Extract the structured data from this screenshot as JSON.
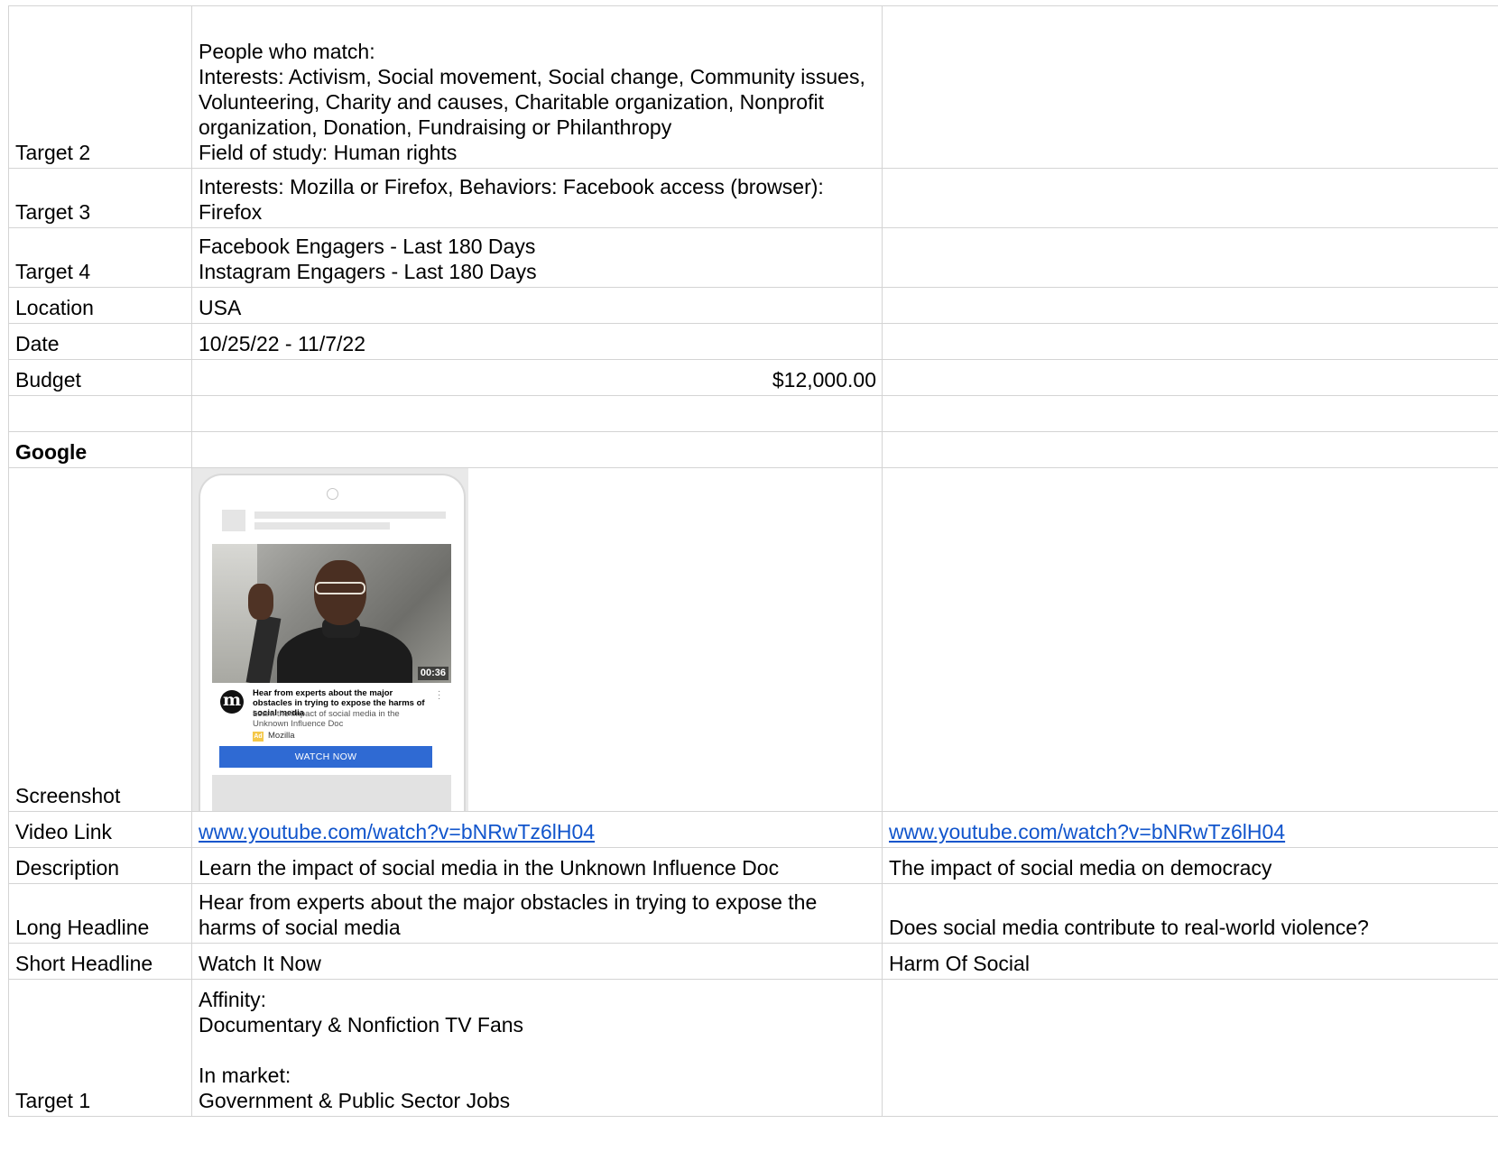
{
  "rows": {
    "target2": {
      "label": "Target 2",
      "value": "People who match:\nInterests: Activism, Social movement, Social change, Community issues, Volunteering, Charity and causes, Charitable organization, Nonprofit organization, Donation, Fundraising or Philanthropy\nField of study: Human rights",
      "value2": ""
    },
    "target3": {
      "label": "Target 3",
      "value": "Interests: Mozilla or Firefox, Behaviors: Facebook access (browser): Firefox"
    },
    "target4": {
      "label": "Target 4",
      "value": "Facebook Engagers - Last 180 Days\nInstagram Engagers - Last 180 Days"
    },
    "location": {
      "label": "Location",
      "value": "USA"
    },
    "date": {
      "label": "Date",
      "value": "10/25/22 - 11/7/22"
    },
    "budget": {
      "label": "Budget",
      "value": "$12,000.00"
    },
    "google": {
      "label": "Google"
    },
    "screenshot": {
      "label": "Screenshot"
    },
    "video_link": {
      "label": "Video Link",
      "value": "www.youtube.com/watch?v=bNRwTz6lH04",
      "value2": "www.youtube.com/watch?v=bNRwTz6lH04"
    },
    "description": {
      "label": "Description",
      "value": "Learn the impact of social media in the Unknown Influence Doc",
      "value2": "The impact of social media on democracy"
    },
    "long_headline": {
      "label": "Long Headline",
      "value": "Hear from experts about the major obstacles in trying to expose the harms of social media",
      "value2": "Does social media contribute to real-world violence?"
    },
    "short_headline": {
      "label": "Short Headline",
      "value": "Watch It Now",
      "value2": "Harm Of Social"
    },
    "target1": {
      "label": "Target 1",
      "value": "Affinity:\nDocumentary & Nonfiction TV Fans\n\nIn market:\nGovernment & Public Sector Jobs"
    }
  },
  "ad_preview": {
    "duration": "00:36",
    "logo_letter": "m",
    "headline": "Hear from experts about the major obstacles in trying to expose the harms of social media",
    "description": "Learn the impact of social media in the Unknown Influence Doc",
    "ad_badge": "Ad",
    "advertiser": "Mozilla",
    "cta": "WATCH NOW",
    "cta_color": "#2f6ad3",
    "logo_icon": "mozilla-m-logo-icon",
    "menu_icon": "vertical-dots-icon"
  },
  "colors": {
    "link": "#1155cc",
    "grid": "#d4d4d4"
  }
}
